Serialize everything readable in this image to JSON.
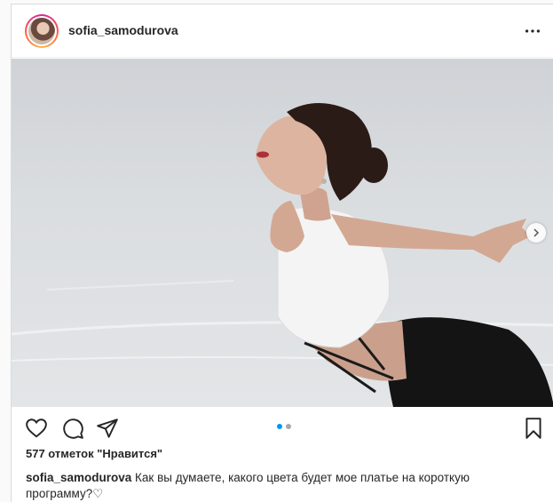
{
  "post": {
    "username": "sofia_samodurova",
    "likes_text": "577 отметок \"Нравится\"",
    "caption_user": "sofia_samodurova",
    "caption_text": " Как вы думаете, какого цвета будет мое платье на короткую программу?",
    "caption_emoji": "♡",
    "carousel": {
      "total": 2,
      "current": 1
    }
  },
  "icons": {
    "more": "more-horizontal-icon",
    "like": "heart-icon",
    "comment": "comment-icon",
    "share": "send-icon",
    "save": "bookmark-icon",
    "next": "chevron-right-icon"
  },
  "colors": {
    "accent": "#0095f6",
    "text": "#262626",
    "border": "#dbdbdb"
  }
}
